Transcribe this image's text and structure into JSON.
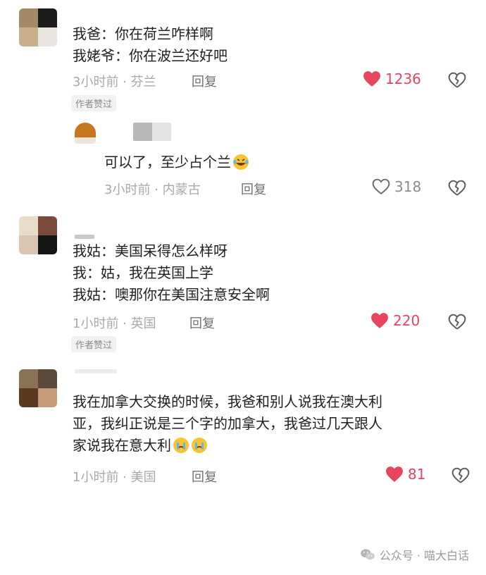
{
  "comments": [
    {
      "lines": [
        "我爸：你在荷兰咋样啊",
        "我姥爷：你在波兰还好吧"
      ],
      "time_loc": "3小时前 · 芬兰",
      "reply": "回复",
      "likes": "1236",
      "liked": true,
      "author_liked": "作者赞过"
    },
    {
      "lines": [
        "可以了，至少占个兰"
      ],
      "time_loc": "3小时前 · 内蒙古",
      "reply": "回复",
      "likes": "318",
      "liked": false
    },
    {
      "lines": [
        "我姑：美国呆得怎么样呀",
        "我：姑，我在英国上学",
        "我姑：噢那你在美国注意安全啊"
      ],
      "time_loc": "1小时前 · 英国",
      "reply": "回复",
      "likes": "220",
      "liked": true,
      "author_liked": "作者赞过"
    },
    {
      "lines": [
        "我在加拿大交换的时候，我爸和别人说我在澳大利",
        "亚，我纠正说是三个字的加拿大，我爸过几天跟人",
        "家说我在意大利"
      ],
      "time_loc": "1小时前 · 美国",
      "reply": "回复",
      "likes": "81",
      "liked": true
    }
  ],
  "icons": {
    "heart": "heart-icon",
    "dislike": "broken-heart-icon",
    "laugh": "laughing-tears-emoji",
    "cry": "crying-emoji",
    "wechat": "wechat-icon"
  },
  "colors": {
    "like_red": "#e6445f",
    "meta_gray": "#a9a9a9"
  },
  "footer": {
    "text": "公众号 · 喵大白话"
  }
}
